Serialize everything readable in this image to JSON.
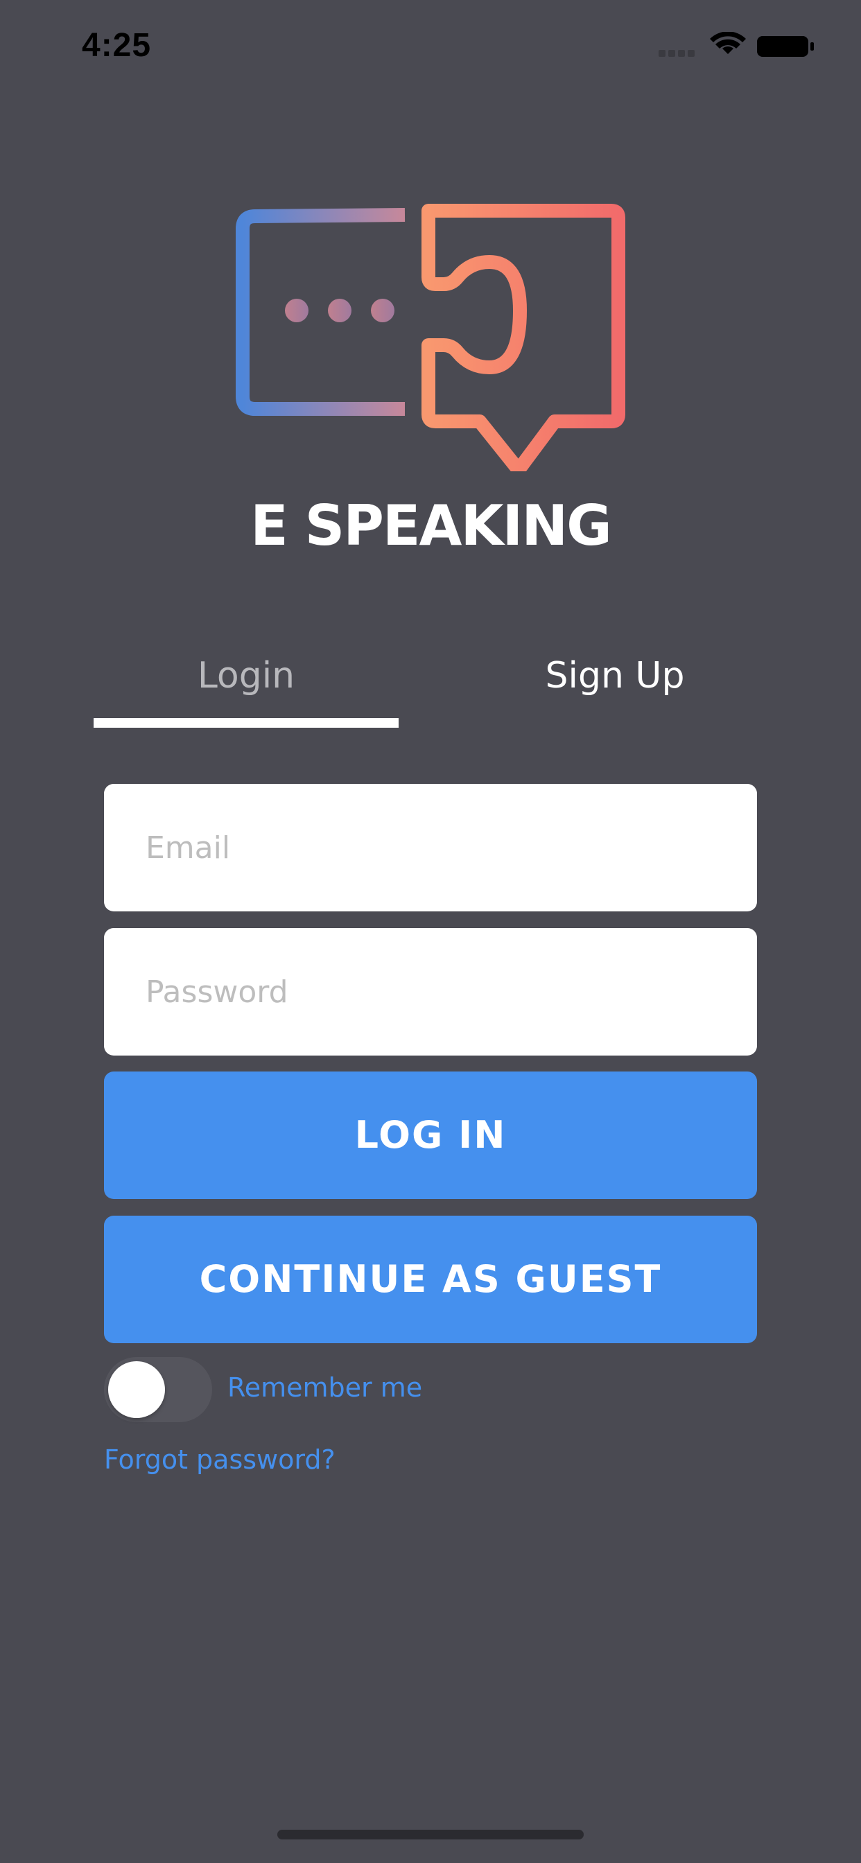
{
  "status_bar": {
    "time": "4:25",
    "icons": [
      "signal-icon",
      "wifi-icon",
      "battery-icon"
    ]
  },
  "brand": {
    "name": "E SPEAKING",
    "logo_icon": "speech-puzzle-logo",
    "gradient_colors": [
      "#4f86d9",
      "#f88f6b",
      "#f26b6b"
    ]
  },
  "tabs": {
    "login_label": "Login",
    "signup_label": "Sign Up",
    "active": "Login"
  },
  "form": {
    "email_value": "",
    "email_placeholder": "Email",
    "password_value": "",
    "password_placeholder": "Password",
    "login_button": "LOG IN",
    "guest_button": "CONTINUE AS GUEST",
    "remember_me_label": "Remember me",
    "remember_me_on": false,
    "forgot_password_label": "Forgot password?"
  },
  "colors": {
    "background": "#4a4a52",
    "accent": "#4590ee",
    "text_primary": "#ffffff",
    "text_inactive": "#b8b8bc"
  }
}
